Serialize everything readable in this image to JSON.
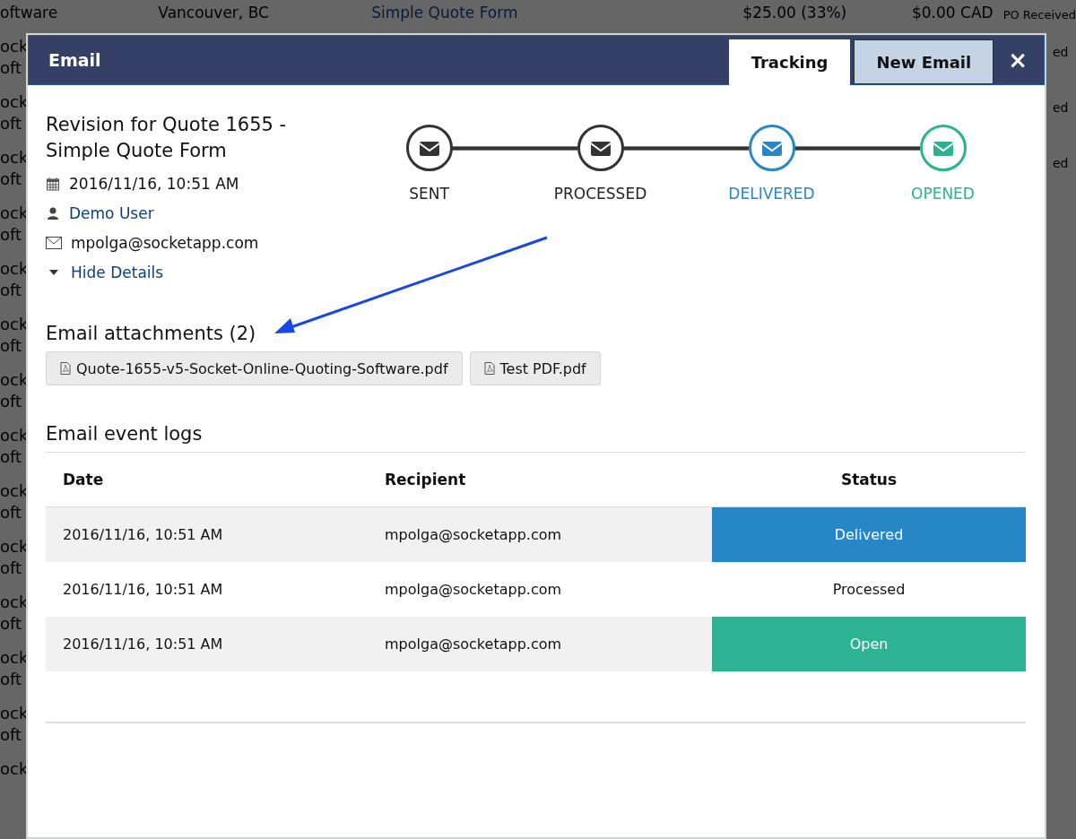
{
  "background": {
    "top_row": [
      "oftware",
      "Vancouver, BC",
      "Simple Quote Form",
      "$25.00 (33%)",
      "$0.00 CAD",
      "PO Received"
    ],
    "left_rows": [
      [
        "ock",
        "oft"
      ],
      [
        "ock",
        "oft"
      ],
      [
        "ock",
        "oft"
      ],
      [
        "ock",
        "oft"
      ],
      [
        "ock",
        "oft"
      ],
      [
        "ock",
        "oft"
      ],
      [
        "ock",
        "oft"
      ],
      [
        "ock",
        "oft"
      ],
      [
        "ock",
        "oft"
      ],
      [
        "ock",
        "oft"
      ],
      [
        "ock",
        "oft"
      ],
      [
        "ock",
        "oft"
      ],
      [
        "ock",
        "oft"
      ],
      [
        "ock"
      ]
    ],
    "right_rows": [
      "ed",
      "ed",
      "ed"
    ]
  },
  "modal": {
    "title": "Email",
    "tabs": [
      {
        "label": "Tracking",
        "selected": true
      },
      {
        "label": "New Email",
        "selected": false
      }
    ],
    "close": "×"
  },
  "details": {
    "subject": "Revision for Quote 1655 - Simple Quote Form",
    "date": "2016/11/16, 10:51 AM",
    "user": "Demo User",
    "email": "mpolga@socketapp.com",
    "toggle": "Hide Details",
    "expanded": true
  },
  "steps": [
    {
      "label": "SENT",
      "color": "#333333"
    },
    {
      "label": "PROCESSED",
      "color": "#333333"
    },
    {
      "label": "DELIVERED",
      "color": "#2a87c5"
    },
    {
      "label": "OPENED",
      "color": "#2bb38f"
    }
  ],
  "attachments": {
    "title": "Email attachments (2)",
    "files": [
      "Quote-1655-v5-Socket-Online-Quoting-Software.pdf",
      "Test PDF.pdf"
    ]
  },
  "event_logs": {
    "title": "Email event logs",
    "columns": [
      "Date",
      "Recipient",
      "Status"
    ],
    "rows": [
      {
        "date": "2016/11/16, 10:51 AM",
        "recipient": "mpolga@socketapp.com",
        "status": "Delivered",
        "kind": "delivered"
      },
      {
        "date": "2016/11/16, 10:51 AM",
        "recipient": "mpolga@socketapp.com",
        "status": "Processed",
        "kind": "processed"
      },
      {
        "date": "2016/11/16, 10:51 AM",
        "recipient": "mpolga@socketapp.com",
        "status": "Open",
        "kind": "open"
      }
    ]
  }
}
